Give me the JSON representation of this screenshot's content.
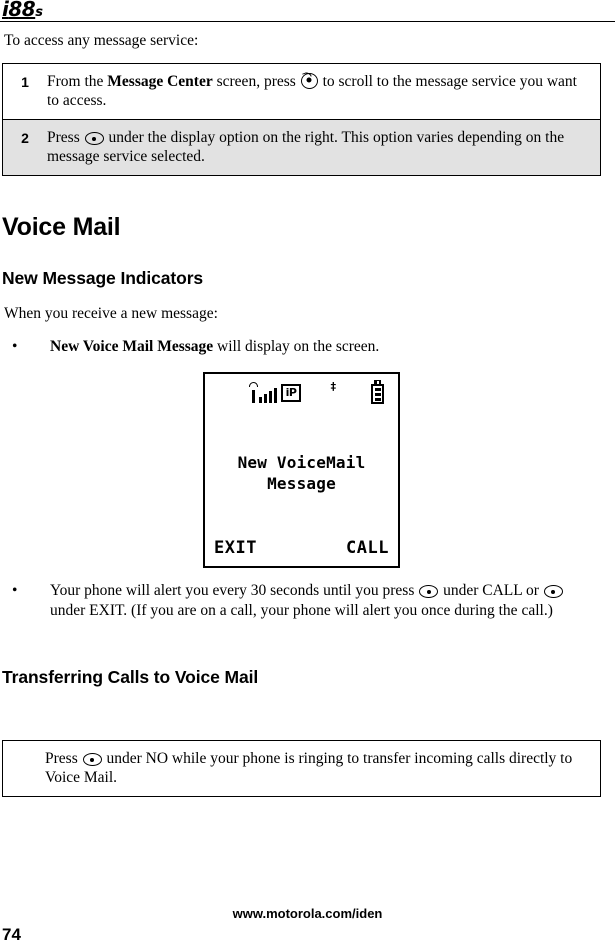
{
  "header": {
    "logo_i": "i",
    "logo_number": "88",
    "logo_suffix": "s"
  },
  "intro": {
    "text": "To access any message service:"
  },
  "procedure": {
    "steps": [
      {
        "number": "1",
        "text_before": "From the ",
        "bold": "Message Center",
        "text_after_bold": " screen, press ",
        "icon": "navigation-disc-key",
        "text_end": " to scroll to the message service you want to access."
      },
      {
        "number": "2",
        "text_before": "Press ",
        "icon": "select-key",
        "text_end": " under the display option on the right. This option varies depending on the message service selected."
      }
    ]
  },
  "headings": {
    "voice_mail": "Voice Mail",
    "new_message_indicators": "New Message Indicators",
    "transferring_calls": "Transferring Calls to Voice Mail"
  },
  "paragraphs": {
    "when_receive": "When you receive a new message:"
  },
  "bullets": {
    "marker": "•",
    "item1": {
      "bold": "New Voice Mail Message",
      "rest": " will display on the screen."
    },
    "item2": {
      "part1": "Your phone will alert you every 30 seconds until you press ",
      "icon1": "select-key",
      "part2": " under CALL or ",
      "icon2": "select-key",
      "part3": " under EXIT. (If you are on a call, your phone will alert you once during the call.)"
    }
  },
  "phone_screen": {
    "status": {
      "signal_icon": "signal-strength-icon",
      "signal_bars": 4,
      "ip_icon_label": "iP",
      "message_mark": "‡",
      "battery_icon": "battery-icon",
      "battery_segments": 3
    },
    "message_line1": "New VoiceMail",
    "message_line2": "Message",
    "softkey_left": "EXIT",
    "softkey_right": "CALL"
  },
  "note": {
    "part1": "Press ",
    "icon": "select-key",
    "part2": " under NO while your phone is ringing to transfer incoming calls directly to Voice Mail."
  },
  "footer": {
    "url": "www.motorola.com/iden",
    "page_number": "74"
  }
}
